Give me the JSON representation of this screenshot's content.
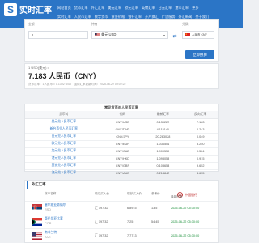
{
  "header": {
    "logo_mark": "S",
    "logo_text": "实时汇率",
    "nav_rows": [
      [
        "网站首页",
        "货币汇率",
        "外汇汇率",
        "美元汇率",
        "欧元汇率",
        "英镑汇率",
        "日元汇率",
        "港币汇率",
        "更多"
      ],
      [
        "实时汇率",
        "人民币汇率",
        "数字货币",
        "黄金价格",
        "银行汇率",
        "开户换汇",
        "广告服务",
        "外汇新闻",
        "关于我们"
      ]
    ]
  },
  "converter": {
    "amount_label": "金额",
    "amount_value": "1",
    "from_label": "持有",
    "from_value": "美元 USD",
    "to_label": "兑换",
    "to_value": "人民币 CNY",
    "swap_icon": "⇄",
    "button_label": "立即换算"
  },
  "result": {
    "line1": "1 USD(美元) =",
    "amount": "7.183 人民币（CNY）",
    "line3": "货币汇率：1人民币 = 0.1392 USD　国际汇率更新时间：2025-06-22 09:02:22"
  },
  "table": {
    "title": "常见货币对人民币汇率",
    "headers": [
      "货币对",
      "代码",
      "最新汇率",
      "反向汇率"
    ],
    "rows": [
      [
        "美元兑人民币汇率",
        "CNY/USD",
        "0.139222",
        "7.183"
      ],
      [
        "新台币兑人民币汇率",
        "CNY/TWD",
        "4.115141",
        "0.243"
      ],
      [
        "日元兑人民币汇率",
        "CNY/JPY",
        "20.283028",
        "0.049"
      ],
      [
        "欧元兑人民币汇率",
        "CNY/EUR",
        "1.036501",
        "8.250"
      ],
      [
        "加元兑人民币汇率",
        "CNY/CAD",
        "1.909550",
        "0.524"
      ],
      [
        "港元兑人民币汇率",
        "CNY/HKD",
        "1.093058",
        "0.915"
      ],
      [
        "英镑兑人民币汇率",
        "CNY/GBP",
        "0.103653",
        "9.652"
      ],
      [
        "澳元兑人民币汇率",
        "CNY/AUD",
        "0.214842",
        "4.655"
      ]
    ]
  },
  "comparison": {
    "title": "外汇汇率",
    "columns": [
      "货币名称",
      "现汇买入价",
      "现钞买入价",
      "参考价",
      "最新时间"
    ],
    "bank_name": "中国银行",
    "rows": [
      {
        "name": "塞尔维亚第纳尔",
        "sub": "RSD",
        "buy": "汇 197.32",
        "cash": "6.8915",
        "ref": "13.5",
        "time": "2025-06-22 05:30:00"
      },
      {
        "name": "哥伦比亚比索",
        "sub": "COP",
        "buy": "汇 197.32",
        "cash": "7.25",
        "ref": "54.45",
        "time": "2025-06-22 05:30:00"
      },
      {
        "name": "南非兰特",
        "sub": "ZAR",
        "buy": "汇 197.32",
        "cash": "7.7713",
        "ref": "",
        "time": "2025-06-22 05:30:00"
      }
    ]
  }
}
